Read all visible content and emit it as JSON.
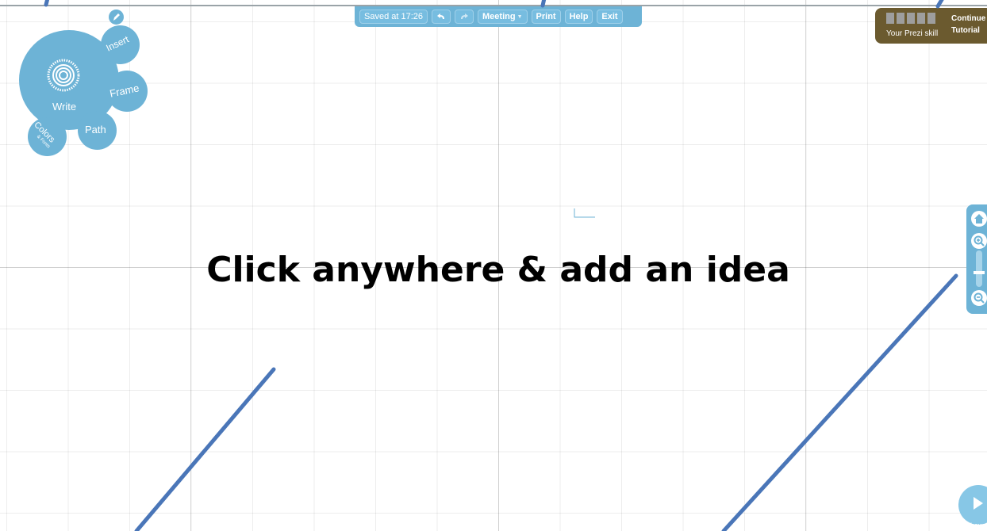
{
  "toolbar": {
    "saved": "Saved at 17:26",
    "meeting": "Meeting",
    "print": "Print",
    "help": "Help",
    "exit": "Exit"
  },
  "bubble_menu": {
    "write": "Write",
    "insert": "Insert",
    "frame": "Frame",
    "path": "Path",
    "colors": "Colors",
    "fonts": "& Fonts"
  },
  "skill": {
    "label": "Your Prezi skill",
    "continue": "Continue",
    "tutorial": "Tutorial"
  },
  "canvas": {
    "prompt": "Click anywhere & add an idea"
  },
  "zoom": {
    "home_icon": "home-icon",
    "zoom_in_icon": "zoom-in-icon",
    "zoom_out_icon": "zoom-out-icon"
  },
  "show": {
    "label": "Show"
  },
  "colors": {
    "accent": "#6db3d6",
    "skill_panel": "#6b5a2f",
    "annotation_arrow": "#4a76b8"
  }
}
